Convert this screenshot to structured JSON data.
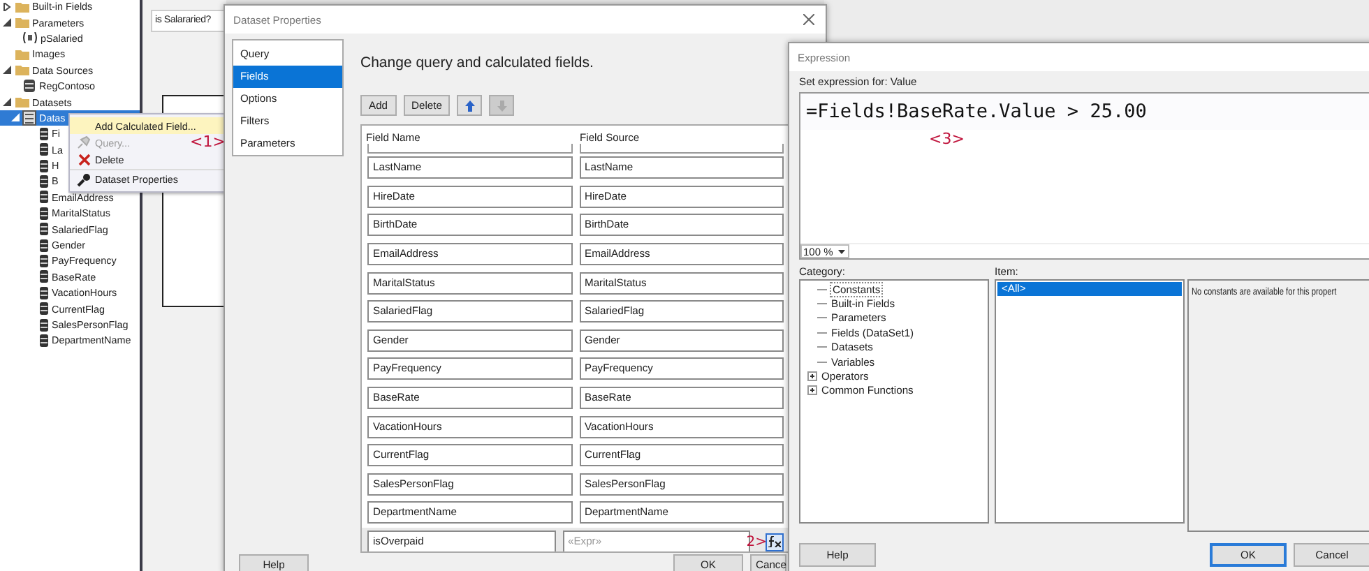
{
  "report_data": {
    "items": [
      {
        "label": "Built-in Fields",
        "kind": "folder",
        "expanded": false,
        "selected": false
      },
      {
        "label": "Parameters",
        "kind": "folder",
        "expanded": true,
        "selected": false,
        "children": [
          {
            "label": "pSalaried",
            "kind": "parameter",
            "selected": false
          }
        ]
      },
      {
        "label": "Images",
        "kind": "folder",
        "selected": false
      },
      {
        "label": "Data Sources",
        "kind": "folder",
        "expanded": true,
        "selected": false,
        "children": [
          {
            "label": "RegContoso",
            "kind": "datasource",
            "selected": false
          }
        ]
      },
      {
        "label": "Datasets",
        "kind": "folder",
        "expanded": true,
        "selected": false,
        "children": [
          {
            "label": "Datas",
            "kind": "dataset",
            "expanded": true,
            "selected": true,
            "children": [
              {
                "label": "Fi",
                "kind": "field",
                "selected": false
              },
              {
                "label": "La",
                "kind": "field",
                "selected": false
              },
              {
                "label": "H",
                "kind": "field",
                "selected": false
              },
              {
                "label": "B",
                "kind": "field",
                "selected": false
              },
              {
                "label": "EmailAddress",
                "kind": "field",
                "selected": false
              },
              {
                "label": "MaritalStatus",
                "kind": "field",
                "selected": false
              },
              {
                "label": "SalariedFlag",
                "kind": "field",
                "selected": false
              },
              {
                "label": "Gender",
                "kind": "field",
                "selected": false
              },
              {
                "label": "PayFrequency",
                "kind": "field",
                "selected": false
              },
              {
                "label": "BaseRate",
                "kind": "field",
                "selected": false
              },
              {
                "label": "VacationHours",
                "kind": "field",
                "selected": false
              },
              {
                "label": "CurrentFlag",
                "kind": "field",
                "selected": false
              },
              {
                "label": "SalesPersonFlag",
                "kind": "field",
                "selected": false
              },
              {
                "label": "DepartmentName",
                "kind": "field",
                "selected": false
              }
            ]
          }
        ]
      }
    ]
  },
  "designer": {
    "textbox": "is Salararied?"
  },
  "context_menu": {
    "items": [
      {
        "label": "Add Calculated Field...",
        "kind": "none",
        "selected": true,
        "disabled": false
      },
      {
        "label": "Query...",
        "kind": "query",
        "selected": false,
        "disabled": true
      },
      {
        "label": "Delete",
        "kind": "delete",
        "selected": false,
        "disabled": false
      },
      {
        "label": "Dataset Properties",
        "kind": "properties",
        "selected": false,
        "disabled": false
      }
    ],
    "annotation": "<1>"
  },
  "dataset_properties": {
    "title": "Dataset Properties",
    "nav": [
      {
        "label": "Query",
        "selected": false
      },
      {
        "label": "Fields",
        "selected": true
      },
      {
        "label": "Options",
        "selected": false
      },
      {
        "label": "Filters",
        "selected": false
      },
      {
        "label": "Parameters",
        "selected": false
      }
    ],
    "heading": "Change query and calculated fields.",
    "toolbar": [
      {
        "kind": "text",
        "label": "Add",
        "disabled": false
      },
      {
        "kind": "text",
        "label": "Delete",
        "disabled": false
      },
      {
        "kind": "up",
        "disabled": false
      },
      {
        "kind": "down",
        "disabled": true
      }
    ],
    "columns": [
      "Field Name",
      "Field Source"
    ],
    "rows": [
      {
        "name": "LastName",
        "source": "LastName",
        "calculated": false
      },
      {
        "name": "HireDate",
        "source": "HireDate",
        "calculated": false
      },
      {
        "name": "BirthDate",
        "source": "BirthDate",
        "calculated": false
      },
      {
        "name": "EmailAddress",
        "source": "EmailAddress",
        "calculated": false
      },
      {
        "name": "MaritalStatus",
        "source": "MaritalStatus",
        "calculated": false
      },
      {
        "name": "SalariedFlag",
        "source": "SalariedFlag",
        "calculated": false
      },
      {
        "name": "Gender",
        "source": "Gender",
        "calculated": false
      },
      {
        "name": "PayFrequency",
        "source": "PayFrequency",
        "calculated": false
      },
      {
        "name": "BaseRate",
        "source": "BaseRate",
        "calculated": false
      },
      {
        "name": "VacationHours",
        "source": "VacationHours",
        "calculated": false
      },
      {
        "name": "CurrentFlag",
        "source": "CurrentFlag",
        "calculated": false
      },
      {
        "name": "SalesPersonFlag",
        "source": "SalesPersonFlag",
        "calculated": false
      },
      {
        "name": "DepartmentName",
        "source": "DepartmentName",
        "calculated": false
      },
      {
        "name": "isOverpaid",
        "source": "«Expr»",
        "calculated": true
      }
    ],
    "annotation": "2>",
    "buttons": [
      "Help",
      "OK",
      "Cance"
    ]
  },
  "expression": {
    "title": "Expression",
    "prompt": "Set expression for: Value",
    "code": "=Fields!BaseRate.Value > 25.00",
    "annotation": "<3>",
    "zoom": "100 %",
    "category_label": "Category:",
    "categories": [
      {
        "label": "Constants",
        "selected": true,
        "expandable": false
      },
      {
        "label": "Built-in Fields",
        "selected": false,
        "expandable": false
      },
      {
        "label": "Parameters",
        "selected": false,
        "expandable": false
      },
      {
        "label": "Fields (DataSet1)",
        "selected": false,
        "expandable": false
      },
      {
        "label": "Datasets",
        "selected": false,
        "expandable": false
      },
      {
        "label": "Variables",
        "selected": false,
        "expandable": false
      },
      {
        "label": "Operators",
        "selected": false,
        "expandable": true
      },
      {
        "label": "Common Functions",
        "selected": false,
        "expandable": true
      }
    ],
    "item_label": "Item:",
    "items": [
      {
        "label": "<All>",
        "selected": true
      }
    ],
    "description": "No constants are available for this propert",
    "buttons": [
      {
        "label": "Help",
        "default": false
      },
      {
        "label": "OK",
        "default": true
      },
      {
        "label": "Cancel",
        "default": false
      }
    ]
  }
}
